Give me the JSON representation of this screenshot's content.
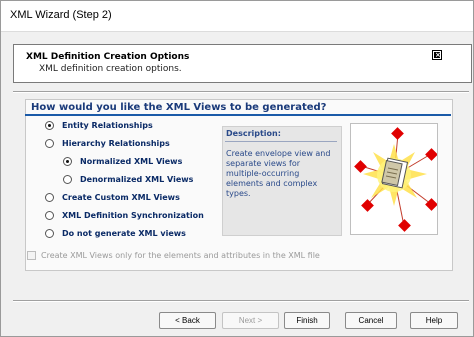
{
  "window": {
    "title": "XML Wizard (Step 2)"
  },
  "header": {
    "title": "XML Definition Creation Options",
    "subtitle": "XML definition creation options."
  },
  "question": "How would you like the XML Views to be generated?",
  "options": [
    {
      "label": "Entity Relationships",
      "selected": true
    },
    {
      "label": "Hierarchy Relationships",
      "selected": false
    },
    {
      "label": "Normalized XML Views",
      "selected": true
    },
    {
      "label": "Denormalized XML Views",
      "selected": false
    },
    {
      "label": "Create Custom XML Views",
      "selected": false
    },
    {
      "label": "XML Definition Synchronization",
      "selected": false
    },
    {
      "label": "Do not generate XML views",
      "selected": false
    }
  ],
  "description": {
    "label": "Description:",
    "text": "Create envelope view and separate views for multiple-occurring elements and complex types."
  },
  "checkbox": {
    "label": "Create XML Views only for the elements and attributes in the XML file",
    "checked": false,
    "enabled": false
  },
  "buttons": {
    "back": "< Back",
    "next": "Next >",
    "finish": "Finish",
    "cancel": "Cancel",
    "help": "Help"
  },
  "colors": {
    "accent": "#1a5aa8",
    "heading": "#1a3a7a",
    "option_text": "#0a2a66",
    "node": "#e00000"
  }
}
